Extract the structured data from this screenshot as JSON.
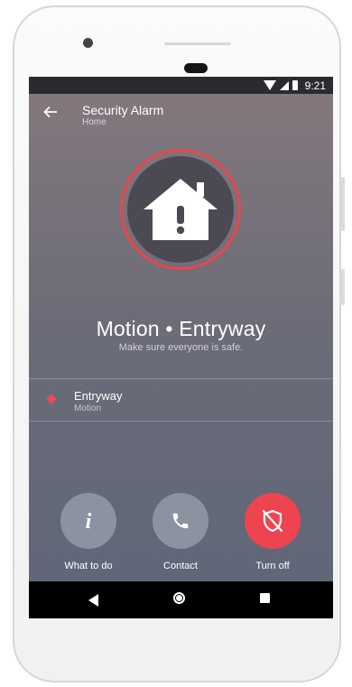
{
  "status_bar": {
    "time": "9:21"
  },
  "app_bar": {
    "title": "Security Alarm",
    "subtitle": "Home"
  },
  "alert": {
    "headline": "Motion • Entryway",
    "message": "Make sure everyone is safe."
  },
  "events": [
    {
      "title": "Entryway",
      "subtitle": "Motion"
    }
  ],
  "actions": [
    {
      "label": "What to do",
      "icon": "info-icon"
    },
    {
      "label": "Contact",
      "icon": "phone-icon"
    },
    {
      "label": "Turn off",
      "icon": "shield-off-icon"
    }
  ],
  "colors": {
    "accent_red": "#ee4450",
    "button_grey": "#8b93a3"
  }
}
